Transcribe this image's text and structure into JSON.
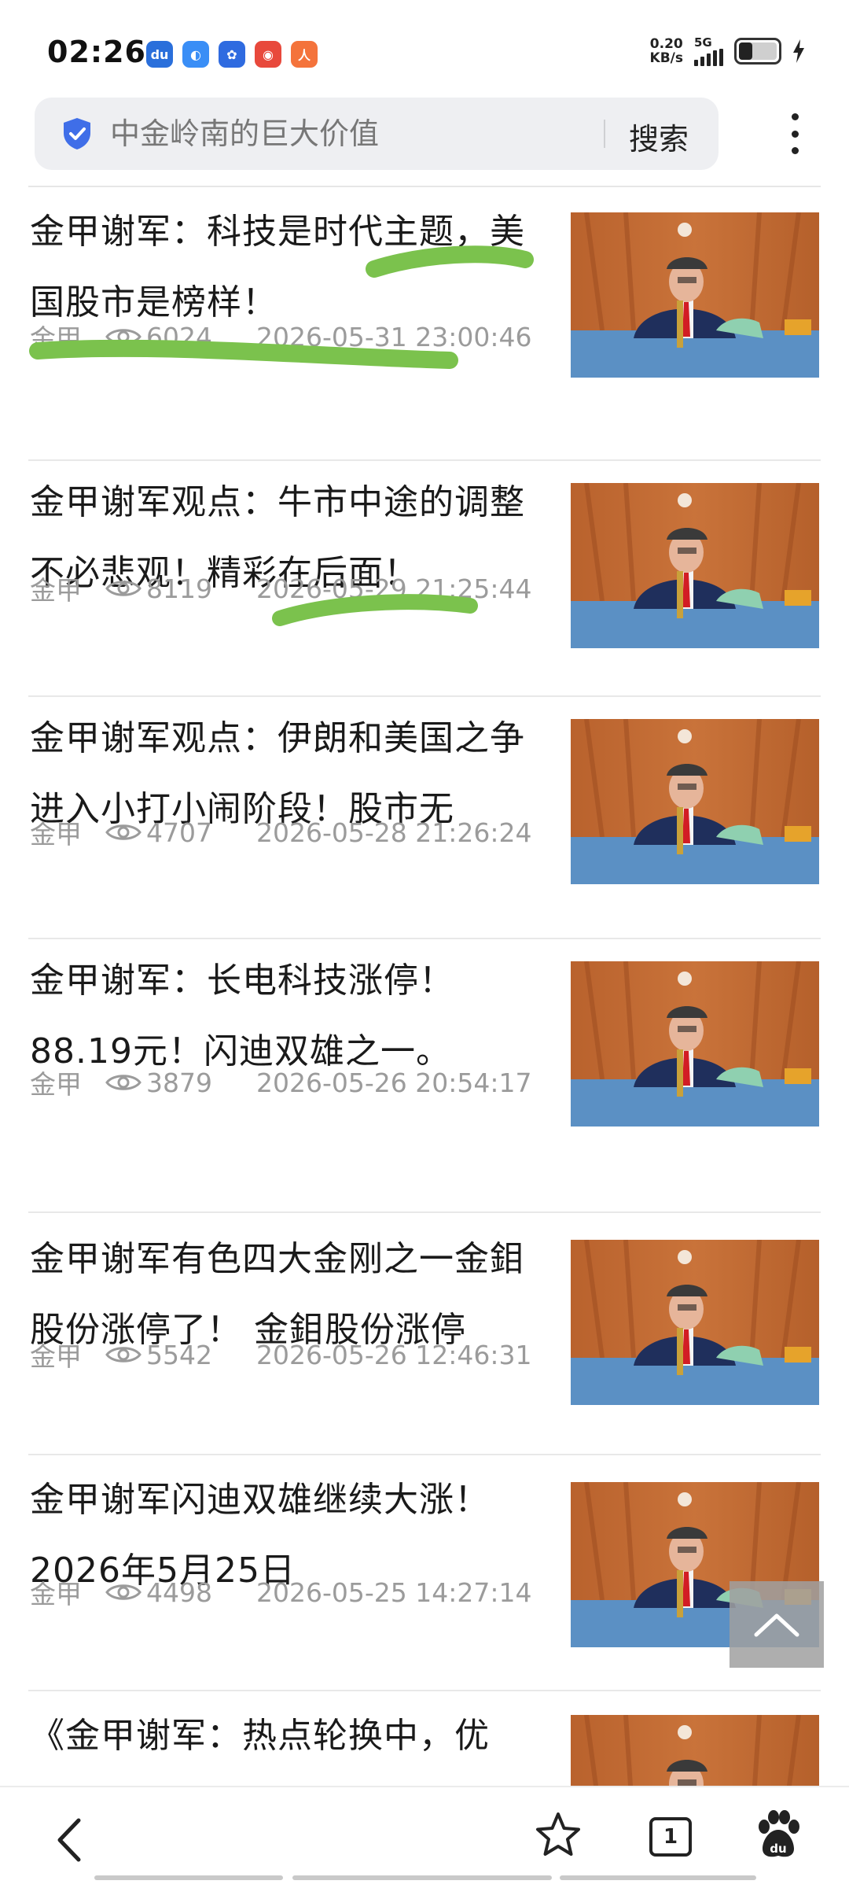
{
  "status_bar": {
    "time": "02:26",
    "net_speed_value": "0.20",
    "net_speed_unit": "KB/s",
    "network": "5G",
    "battery_level": 0.35,
    "charging": true,
    "app_icons": [
      {
        "name": "baidu-app-icon",
        "color": "#2a6fdb",
        "glyph": "du"
      },
      {
        "name": "baidu-netdisk-icon",
        "color": "#3a8ef6",
        "glyph": "◐"
      },
      {
        "name": "baidu-paw-icon",
        "color": "#2f6be0",
        "glyph": "✿"
      },
      {
        "name": "chrome-like-icon",
        "color": "#e8493c",
        "glyph": "◉"
      },
      {
        "name": "orange-app-icon",
        "color": "#f4733b",
        "glyph": "人"
      }
    ]
  },
  "search": {
    "placeholder": "中金岭南的巨大价值",
    "button_label": "搜索"
  },
  "colors": {
    "highlight_marker": "#7bc24d",
    "meta_text": "#9b9b9b",
    "thumb_bg": "#c9733a",
    "table_cloth": "#5b90c4"
  },
  "feed": [
    {
      "title": "金甲谢军：科技是时代主题，美国股市是榜样！",
      "source": "金甲",
      "views": "6024",
      "date": "2026-05-31 23:00:46"
    },
    {
      "title": "金甲谢军观点：牛市中途的调整不必悲观！精彩在后面！",
      "source": "金甲",
      "views": "8119",
      "date": "2026-05-29 21:25:44"
    },
    {
      "title": "金甲谢军观点：伊朗和美国之争进入小打小闹阶段！股市无",
      "source": "金甲",
      "views": "4707",
      "date": "2026-05-28 21:26:24"
    },
    {
      "title": "金甲谢军：长电科技涨停！88.19元！闪迪双雄之一。",
      "source": "金甲",
      "views": "3879",
      "date": "2026-05-26 20:54:17"
    },
    {
      "title": "金甲谢军有色四大金刚之一金鉬股份涨停了！ 金鉬股份涨停",
      "source": "金甲",
      "views": "5542",
      "date": "2026-05-26 12:46:31"
    },
    {
      "title": "金甲谢军闪迪双雄继续大涨！2026年5月25日",
      "source": "金甲",
      "views": "4498",
      "date": "2026-05-25 14:27:14"
    },
    {
      "title": "《金甲谢军：热点轮换中，优",
      "source": "",
      "views": "",
      "date": ""
    }
  ],
  "bottom_nav": {
    "tab_count": "1"
  }
}
